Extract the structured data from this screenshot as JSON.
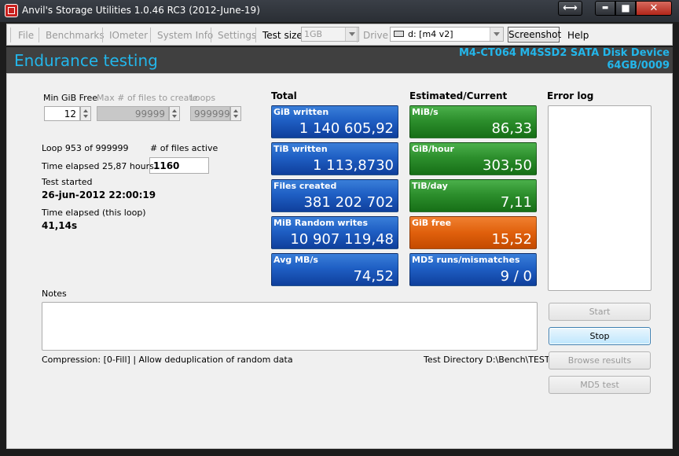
{
  "window": {
    "title": "Anvil's Storage Utilities 1.0.46 RC3 (2012-June-19)"
  },
  "title_buttons": {
    "arrows": "⟷",
    "minimize": "▬",
    "maximize": "■",
    "close": "✕"
  },
  "menu": {
    "file": "File",
    "benchmarks": "Benchmarks",
    "iometer": "IOmeter",
    "system_info": "System Info",
    "settings": "Settings",
    "test_size_label": "Test size",
    "test_size_value": "1GB",
    "drive_label": "Drive",
    "drive_value": "d: [m4 v2]",
    "screenshot": "Screenshot",
    "help": "Help"
  },
  "header": {
    "title": "Endurance testing",
    "device_name": "M4-CT064 M4SSD2 SATA Disk Device",
    "device_size": "64GB/0009"
  },
  "params": {
    "min_gib_free_label": "Min GiB Free",
    "min_gib_free_value": "12",
    "max_files_label": "Max # of files to create",
    "max_files_value": "99999",
    "loops_label": "Loops",
    "loops_value": "999999"
  },
  "status": {
    "loop_text": "Loop 953 of 999999",
    "files_active_label": "# of files active",
    "files_active_value": "1160",
    "time_elapsed_text": "Time elapsed 25,87 hours",
    "test_started_label": "Test started",
    "test_started_value": "26-jun-2012 22:00:19",
    "loop_time_label": "Time elapsed (this loop)",
    "loop_time_value": "41,14s"
  },
  "total": {
    "heading": "Total",
    "tiles": [
      {
        "label": "GiB written",
        "value": "1 140 605,92"
      },
      {
        "label": "TiB written",
        "value": "1 113,8730"
      },
      {
        "label": "Files created",
        "value": "381 202 702"
      },
      {
        "label": "MiB Random writes",
        "value": "10 907 119,48"
      },
      {
        "label": "Avg MB/s",
        "value": "74,52"
      }
    ]
  },
  "estimated": {
    "heading": "Estimated/Current",
    "tiles": [
      {
        "label": "MiB/s",
        "value": "86,33"
      },
      {
        "label": "GiB/hour",
        "value": "303,50"
      },
      {
        "label": "TiB/day",
        "value": "7,11"
      },
      {
        "label": "GiB free",
        "value": "15,52"
      },
      {
        "label": "MD5 runs/mismatches",
        "value": "9 / 0"
      }
    ]
  },
  "colors": {
    "accent": "#23b6ea",
    "tile_blue": "#1f5fc4",
    "tile_green": "#2d8f2d",
    "tile_orange": "#e0600c"
  },
  "error_log": {
    "heading": "Error log"
  },
  "notes": {
    "label": "Notes"
  },
  "footer": {
    "compression": "Compression: [0-Fill]  |  Allow deduplication of random data",
    "test_directory": "Test Directory D:\\Bench\\TEST"
  },
  "buttons": {
    "start": "Start",
    "stop": "Stop",
    "browse": "Browse results",
    "md5": "MD5 test"
  }
}
